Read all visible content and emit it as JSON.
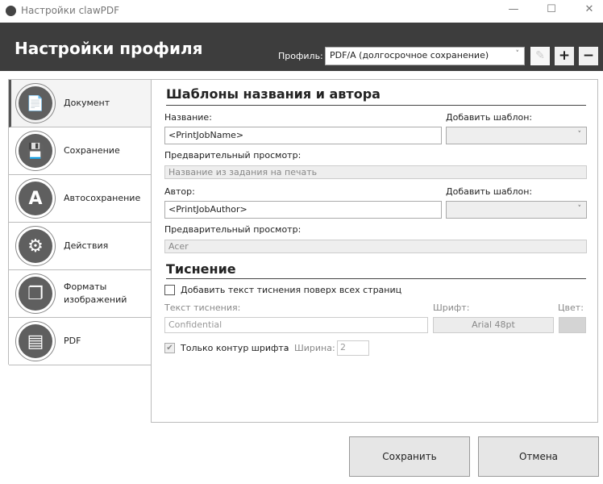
{
  "window": {
    "title": "Настройки clawPDF",
    "minimize": "—",
    "maximize": "☐",
    "close": "✕"
  },
  "header": {
    "title": "Настройки профиля",
    "profile_label": "Профиль:",
    "profile_value": "PDF/A (долгосрочное сохранение)",
    "chevron": "˅",
    "edit": "✎",
    "add": "+",
    "remove": "−"
  },
  "sidebar": {
    "items": [
      {
        "label": "Документ",
        "icon": "📄"
      },
      {
        "label": "Сохранение",
        "icon": "💾"
      },
      {
        "label": "Автосохранение",
        "icon": "A"
      },
      {
        "label": "Действия",
        "icon": "⚙"
      },
      {
        "label": "Форматы изображений",
        "icon": "❐"
      },
      {
        "label": "PDF",
        "icon": "▤"
      }
    ]
  },
  "main": {
    "title_section": "Шаблоны названия и автора",
    "name_label": "Название:",
    "name_value": "<PrintJobName>",
    "add_template_label": "Добавить шаблон:",
    "preview_label": "Предварительный просмотр:",
    "name_preview": "Название из задания на печать",
    "author_label": "Автор:",
    "author_value": "<PrintJobAuthor>",
    "author_preview": "Acer",
    "chevron": "˅",
    "stamp_section": "Тиснение",
    "stamp_checkbox": "Добавить текст тиснения поверх всех страниц",
    "stamp_text_label": "Текст тиснения:",
    "stamp_text": "Confidential",
    "font_label": "Шрифт:",
    "font_value": "Arial 48pt",
    "color_label": "Цвет:",
    "color_value": "#d4d4d4",
    "outline_checkbox": "Только контур шрифта",
    "dash": "-",
    "width_label": "Ширина:",
    "width_value": "2",
    "check": "✔"
  },
  "footer": {
    "save": "Сохранить",
    "cancel": "Отмена"
  }
}
